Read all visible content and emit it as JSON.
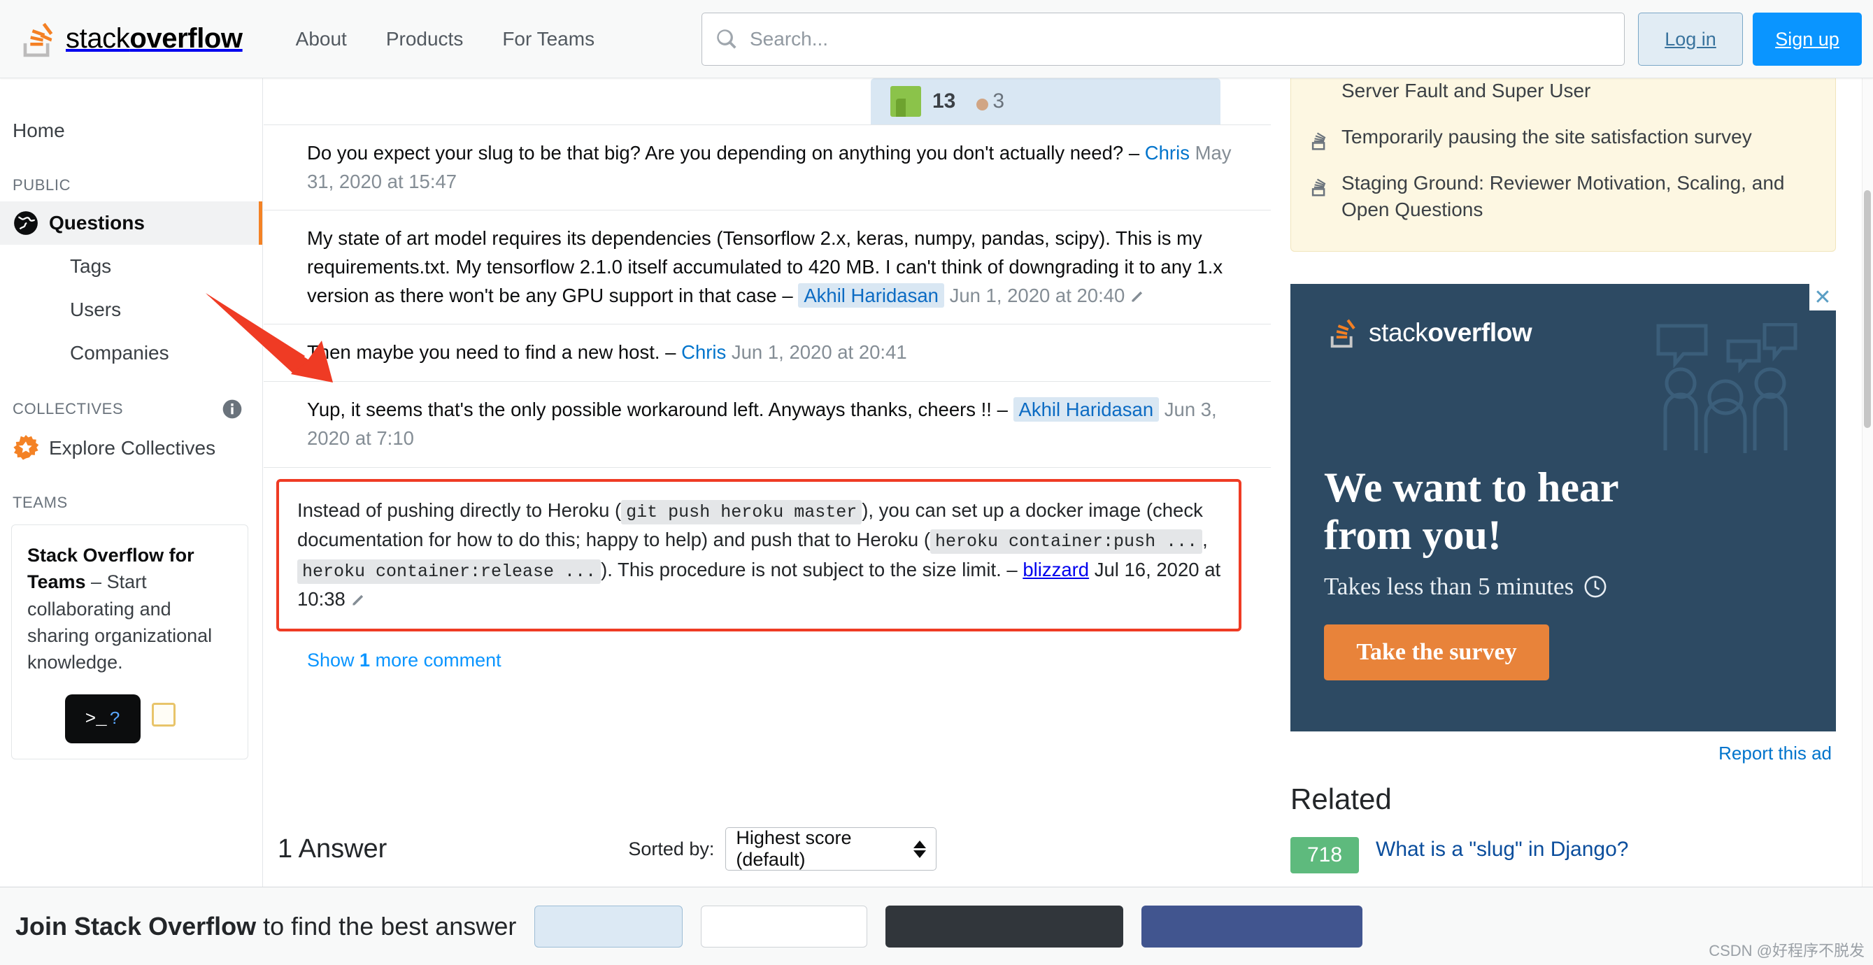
{
  "header": {
    "logo_text_light": "stack",
    "logo_text_bold": "overflow",
    "nav": [
      {
        "label": "About"
      },
      {
        "label": "Products"
      },
      {
        "label": "For Teams"
      }
    ],
    "search": {
      "placeholder": "Search...",
      "value": "",
      "icon": "search-icon"
    },
    "login_label": "Log in",
    "signup_label": "Sign up"
  },
  "sidebar": {
    "home_label": "Home",
    "public_heading": "PUBLIC",
    "public_items": [
      {
        "label": "Questions",
        "icon": "globe-icon",
        "active": true
      },
      {
        "label": "Tags",
        "active": false
      },
      {
        "label": "Users",
        "active": false
      },
      {
        "label": "Companies",
        "active": false
      }
    ],
    "collectives_heading": "COLLECTIVES",
    "collectives_info_icon": "info-icon",
    "collectives_item": {
      "label": "Explore Collectives",
      "icon": "collective-star-icon"
    },
    "teams_heading": "TEAMS",
    "teams_promo": {
      "bold": "Stack Overflow for Teams",
      "rest": " – Start collaborating and sharing organizational knowledge.",
      "terminal_glyph": ">_",
      "terminal_question": "?"
    }
  },
  "main": {
    "user_card": {
      "reputation": "13",
      "badge_count": "3",
      "badge_color": "#d1a584"
    },
    "comments": [
      {
        "text": "Do you expect your slug to be that big? Are you depending on anything you don't actually need? – ",
        "user": "Chris",
        "user_highlight": false,
        "date": "May 31, 2020 at 15:47",
        "has_pencil": false,
        "highlighted": false
      },
      {
        "text": "My state of art model requires its dependencies (Tensorflow 2.x, keras, numpy, pandas, scipy). This is my requirements.txt. My tensorflow 2.1.0 itself accumulated to 420 MB. I can't think of downgrading it to any 1.x version as there won't be any GPU support in that case – ",
        "user": "Akhil Haridasan",
        "user_highlight": true,
        "date": "Jun 1, 2020 at 20:40",
        "has_pencil": true,
        "highlighted": false
      },
      {
        "text": "Then maybe you need to find a new host. – ",
        "user": "Chris",
        "user_highlight": false,
        "date": "Jun 1, 2020 at 20:41",
        "has_pencil": false,
        "highlighted": false
      },
      {
        "text": "Yup, it seems that's the only possible workaround left. Anyways thanks, cheers !! – ",
        "user": "Akhil Haridasan",
        "user_highlight": true,
        "date": "Jun 3, 2020 at 7:10",
        "has_pencil": false,
        "highlighted": false
      }
    ],
    "highlighted_comment": {
      "part1": "Instead of pushing directly to Heroku (",
      "code1": "git push heroku master",
      "part2": "), you can set up a docker image (check documentation for how to do this; happy to help) and push that to Heroku (",
      "code2": "heroku container:push ...",
      "comma": ",",
      "code3": "heroku container:release ...",
      "part3": "). This procedure is not subject to the size limit. – ",
      "user": "blizzard",
      "date": "Jul 16, 2020 at 10:38",
      "has_pencil": true,
      "border_color": "#ef3b24"
    },
    "show_more": {
      "prefix": "Show ",
      "count": "1",
      "suffix": " more comment"
    },
    "answers_title": "1 Answer",
    "sorted_by_label": "Sorted by:",
    "sort_value": "Highest score (default)"
  },
  "rail": {
    "announcements": [
      {
        "icon": "stackoverflow-mini-icon",
        "text": "Retiring Our Community-Specific Closure Reasons for Server Fault and Super User"
      },
      {
        "icon": "stackoverflow-mini-icon",
        "text": "Temporarily pausing the site satisfaction survey"
      },
      {
        "icon": "stackoverflow-mini-icon",
        "text": "Staging Ground: Reviewer Motivation, Scaling, and Open Questions"
      }
    ],
    "ad": {
      "close_icon": "close-icon",
      "logo_light": "stack",
      "logo_bold": "overflow",
      "headline_line1": "We want to hear",
      "headline_line2": "from you!",
      "subtext": "Takes less than 5 minutes",
      "clock_icon": "clock-icon",
      "button_label": "Take the survey",
      "bg_color": "#2d4a63",
      "button_color": "#e8833a"
    },
    "report_ad": "Report this ad",
    "related_title": "Related",
    "related_items": [
      {
        "score": "718",
        "title": "What is a \"slug\" in Django?",
        "score_color": "#5eba7d"
      }
    ]
  },
  "bottombar": {
    "bold": "Join Stack Overflow",
    "rest": " to find the best answer"
  },
  "watermark": "CSDN @好程序不脱发"
}
